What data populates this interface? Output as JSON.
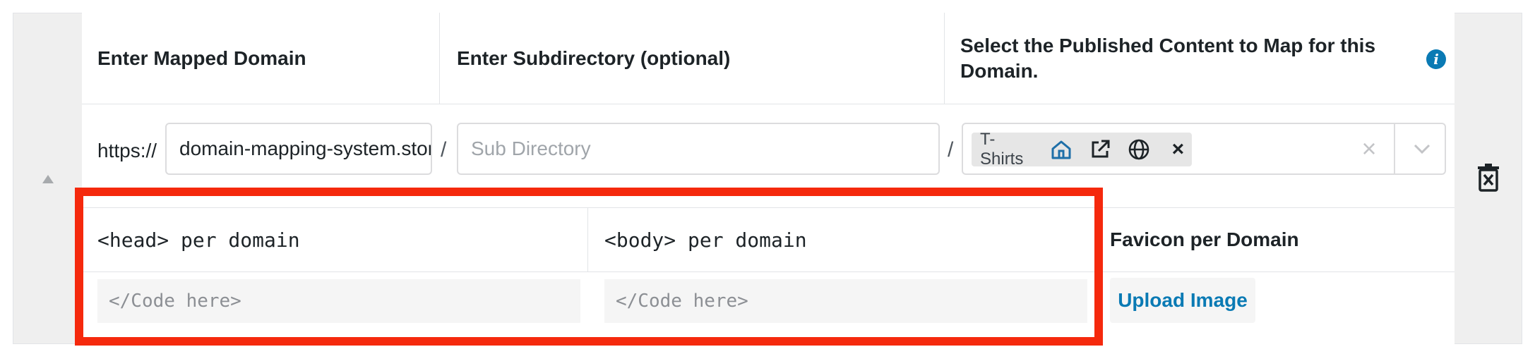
{
  "columns": {
    "mapped_domain": "Enter Mapped Domain",
    "subdirectory": "Enter Subdirectory (optional)",
    "published_content": "Select the Published Content to Map for this Domain."
  },
  "domain_row": {
    "prefix": "https://",
    "domain_value": "domain-mapping-system.store",
    "separator_1": "/",
    "subdirectory_placeholder": "Sub Directory",
    "separator_2": "/",
    "selected_chip_label": "T-Shirts",
    "chip_remove": "×",
    "clear_all": "×"
  },
  "per_domain": {
    "head_label": "<head> per domain",
    "body_label": "<body> per domain",
    "favicon_label": "Favicon per Domain",
    "head_placeholder": "</Code here>",
    "body_placeholder": "</Code here>",
    "upload_button": "Upload Image"
  },
  "colors": {
    "highlight": "#f5290d",
    "info_icon": "#0a7ab4",
    "home_icon": "#1e6fa8",
    "link": "#0a7ab4"
  }
}
